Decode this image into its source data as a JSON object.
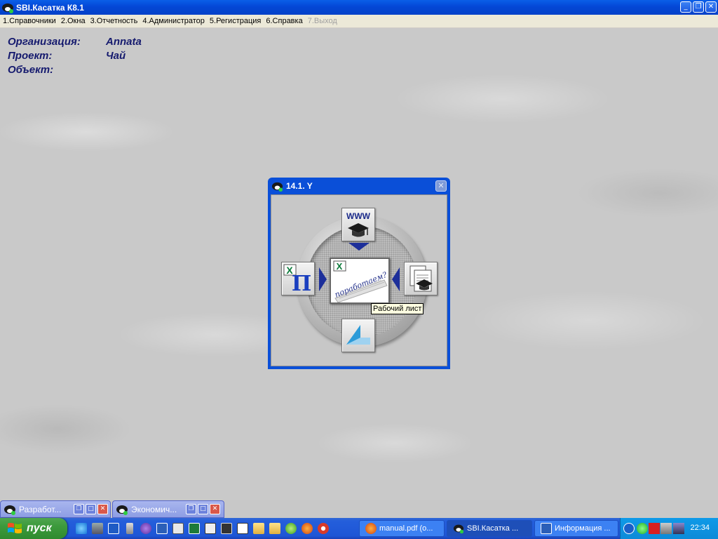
{
  "window": {
    "title": "SBI.Касатка К8.1",
    "controls": [
      "minimize",
      "restore",
      "close"
    ]
  },
  "menu": [
    {
      "label": "1.Справочники",
      "enabled": true
    },
    {
      "label": "2.Окна",
      "enabled": true
    },
    {
      "label": "3.Отчетность",
      "enabled": true
    },
    {
      "label": "4.Администратор",
      "enabled": true
    },
    {
      "label": "5.Регистрация",
      "enabled": true
    },
    {
      "label": "6.Справка",
      "enabled": true
    },
    {
      "label": "7.Выход",
      "enabled": false
    }
  ],
  "info": {
    "org_label": "Организация:",
    "org_value": "Annata",
    "project_label": "Проект:",
    "project_value": "Чай",
    "object_label": "Объект:",
    "object_value": ""
  },
  "dialog": {
    "title": "14.1. Y",
    "top_button_text": "WWW",
    "left_button_text": "П",
    "center_button_text": "поработаем?",
    "tooltip": "Рабочий лист",
    "icons": {
      "top": "www-graduation-cap-icon",
      "left": "excel-pi-icon",
      "right": "documents-graduation-cap-icon",
      "bottom": "blue-corner-icon",
      "center": "worksheet-icon"
    }
  },
  "minimized_windows": [
    {
      "title": "Разработ..."
    },
    {
      "title": "Экономич..."
    }
  ],
  "taskbar": {
    "start_label": "пуск",
    "tasks": [
      {
        "label": "manual.pdf (о...",
        "icon": "firefox-icon",
        "active": false
      },
      {
        "label": "SBI.Касатка ...",
        "icon": "app-icon",
        "active": true
      },
      {
        "label": "Информация ...",
        "icon": "word-icon",
        "active": false
      }
    ],
    "clock": "22:34"
  },
  "colors": {
    "title_blue": "#0447d6",
    "info_text": "#151a6e",
    "taskbar_blue": "#245edb",
    "start_green": "#3c9a3c"
  }
}
